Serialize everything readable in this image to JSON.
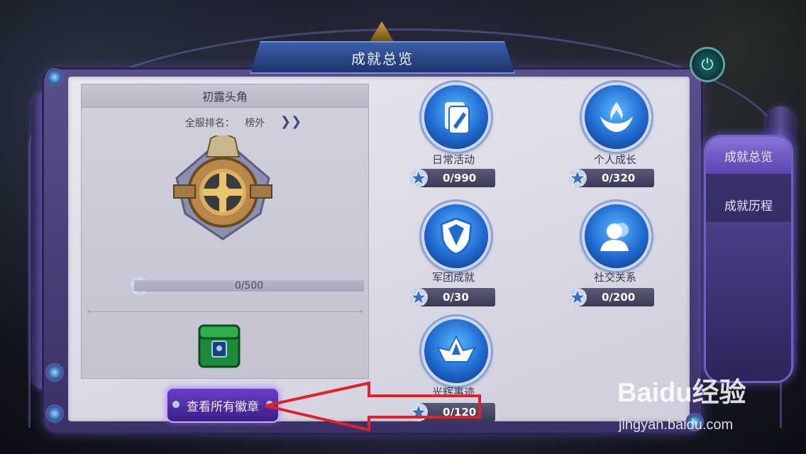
{
  "header": {
    "title": "成就总览"
  },
  "left": {
    "badge_name": "初露头角",
    "rank_label": "全服排名：",
    "rank_value": "榜外",
    "progress_text": "0/500",
    "progress_fraction": 0,
    "view_button": "查看所有徽章"
  },
  "categories": [
    {
      "label": "日常活动",
      "count": "0/990",
      "icon": "document-edit-icon"
    },
    {
      "label": "个人成长",
      "count": "0/320",
      "icon": "flame-hands-icon"
    },
    {
      "label": "军团成就",
      "count": "0/30",
      "icon": "shield-icon"
    },
    {
      "label": "社交关系",
      "count": "0/200",
      "icon": "people-icon"
    },
    {
      "label": "光辉事迹",
      "count": "0/120",
      "icon": "crown-wing-icon"
    }
  ],
  "tabs": [
    {
      "label": "成就总览",
      "active": true
    },
    {
      "label": "成就历程",
      "active": false
    }
  ],
  "watermark": {
    "brand": "Baidu经验",
    "url": "jingyan.baidu.com"
  },
  "colors": {
    "accent": "#5a44b0",
    "icon_blue": "#1f6ad0",
    "annotation": "#e0202a"
  }
}
